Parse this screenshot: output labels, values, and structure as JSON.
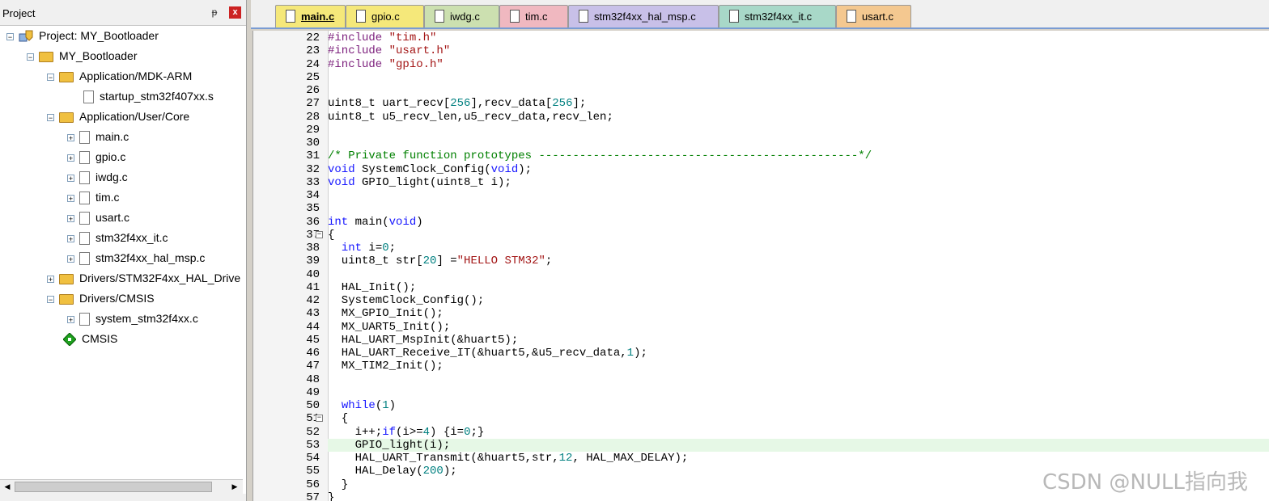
{
  "project_pane": {
    "title": "Project",
    "pin_glyph": "ᵽ",
    "close_glyph": "x",
    "tree": [
      {
        "label": "Project: MY_Bootloader",
        "icon": "project-icon",
        "expander": "−"
      },
      {
        "label": "MY_Bootloader",
        "icon": "target-folder-icon",
        "expander": "−"
      },
      {
        "label": "Application/MDK-ARM",
        "icon": "folder-icon",
        "expander": "−"
      },
      {
        "label": "startup_stm32f407xx.s",
        "icon": "file-icon",
        "expander": ""
      },
      {
        "label": "Application/User/Core",
        "icon": "folder-icon",
        "expander": "−"
      },
      {
        "label": "main.c",
        "icon": "file-icon",
        "expander": "+"
      },
      {
        "label": "gpio.c",
        "icon": "file-icon",
        "expander": "+"
      },
      {
        "label": "iwdg.c",
        "icon": "file-icon",
        "expander": "+"
      },
      {
        "label": "tim.c",
        "icon": "file-icon",
        "expander": "+"
      },
      {
        "label": "usart.c",
        "icon": "file-icon",
        "expander": "+"
      },
      {
        "label": "stm32f4xx_it.c",
        "icon": "file-icon",
        "expander": "+"
      },
      {
        "label": "stm32f4xx_hal_msp.c",
        "icon": "file-icon",
        "expander": "+"
      },
      {
        "label": "Drivers/STM32F4xx_HAL_Drive",
        "icon": "folder-icon",
        "expander": "+"
      },
      {
        "label": "Drivers/CMSIS",
        "icon": "folder-icon",
        "expander": "−"
      },
      {
        "label": "system_stm32f4xx.c",
        "icon": "file-icon",
        "expander": "+"
      },
      {
        "label": "CMSIS",
        "icon": "cmsis-icon",
        "expander": ""
      }
    ],
    "scroll_left": "◀",
    "scroll_right": "▶"
  },
  "tabs": [
    {
      "label": "main.c",
      "active": true,
      "color": "#f5e87a"
    },
    {
      "label": "gpio.c",
      "active": false,
      "color": "#f5e87a"
    },
    {
      "label": "iwdg.c",
      "active": false,
      "color": "#cce0b0"
    },
    {
      "label": "tim.c",
      "active": false,
      "color": "#f0b8c0"
    },
    {
      "label": "stm32f4xx_hal_msp.c",
      "active": false,
      "color": "#c8c0e8"
    },
    {
      "label": "stm32f4xx_it.c",
      "active": false,
      "color": "#a8d8c8"
    },
    {
      "label": "usart.c",
      "active": false,
      "color": "#f4c890"
    }
  ],
  "editor": {
    "lines": [
      {
        "n": "22",
        "html": "<span class=\"pp\">#include </span><span class=\"str\">\"tim.h\"</span>"
      },
      {
        "n": "23",
        "html": "<span class=\"pp\">#include </span><span class=\"str\">\"usart.h\"</span>"
      },
      {
        "n": "24",
        "html": "<span class=\"pp\">#include </span><span class=\"str\">\"gpio.h\"</span>"
      },
      {
        "n": "25",
        "html": ""
      },
      {
        "n": "26",
        "html": ""
      },
      {
        "n": "27",
        "html": "uint8_t uart_recv[<span class=\"num\">256</span>],recv_data[<span class=\"num\">256</span>];"
      },
      {
        "n": "28",
        "html": "uint8_t u5_recv_len,u5_recv_data,recv_len;"
      },
      {
        "n": "29",
        "html": ""
      },
      {
        "n": "30",
        "html": ""
      },
      {
        "n": "31",
        "html": "<span class=\"cmt\">/* Private function prototypes -----------------------------------------------*/</span>"
      },
      {
        "n": "32",
        "html": "<span class=\"kw\">void</span> SystemClock_Config(<span class=\"kw\">void</span>);"
      },
      {
        "n": "33",
        "html": "<span class=\"kw\">void</span> GPIO_light(uint8_t i);"
      },
      {
        "n": "34",
        "html": ""
      },
      {
        "n": "35",
        "html": ""
      },
      {
        "n": "36",
        "html": "<span class=\"kw\">int</span> main(<span class=\"kw\">void</span>)"
      },
      {
        "n": "37",
        "html": "{",
        "fold": "−"
      },
      {
        "n": "38",
        "html": "  <span class=\"kw\">int</span> i=<span class=\"num\">0</span>;"
      },
      {
        "n": "39",
        "html": "  uint8_t str[<span class=\"num\">20</span>] =<span class=\"str\">\"HELLO STM32\"</span>;"
      },
      {
        "n": "40",
        "html": ""
      },
      {
        "n": "41",
        "html": "  HAL_Init();"
      },
      {
        "n": "42",
        "html": "  SystemClock_Config();"
      },
      {
        "n": "43",
        "html": "  MX_GPIO_Init();"
      },
      {
        "n": "44",
        "html": "  MX_UART5_Init();"
      },
      {
        "n": "45",
        "html": "  HAL_UART_MspInit(&amp;huart5);"
      },
      {
        "n": "46",
        "html": "  HAL_UART_Receive_IT(&amp;huart5,&amp;u5_recv_data,<span class=\"num\">1</span>);"
      },
      {
        "n": "47",
        "html": "  MX_TIM2_Init();"
      },
      {
        "n": "48",
        "html": ""
      },
      {
        "n": "49",
        "html": ""
      },
      {
        "n": "50",
        "html": "  <span class=\"kw\">while</span>(<span class=\"num\">1</span>)"
      },
      {
        "n": "51",
        "html": "  {",
        "fold": "−"
      },
      {
        "n": "52",
        "html": "    i++;<span class=\"kw\">if</span>(i&gt;=<span class=\"num\">4</span>) {i=<span class=\"num\">0</span>;}"
      },
      {
        "n": "53",
        "html": "    GPIO_light(i);",
        "highlight": true
      },
      {
        "n": "54",
        "html": "    HAL_UART_Transmit(&amp;huart5,str,<span class=\"num\">12</span>, HAL_MAX_DELAY);"
      },
      {
        "n": "55",
        "html": "    HAL_Delay(<span class=\"num\">200</span>);"
      },
      {
        "n": "56",
        "html": "  }"
      },
      {
        "n": "57",
        "html": "}"
      }
    ]
  },
  "watermark": "CSDN @NULL指向我"
}
